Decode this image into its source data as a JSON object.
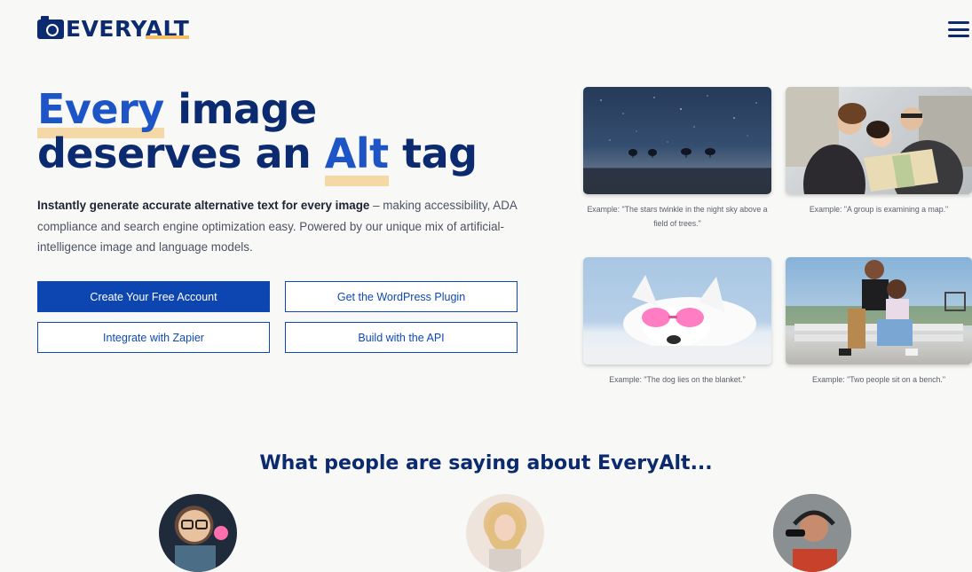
{
  "brand": {
    "name_prefix": "EVERY",
    "name_suffix": "ALT"
  },
  "hero": {
    "headline_line1_highlight": "Every",
    "headline_line1_rest": " image",
    "headline_line2_start": "deserves an ",
    "headline_line2_highlight": "Alt",
    "headline_line2_end": " tag",
    "intro_bold": "Instantly generate accurate alternative text for every image",
    "intro_rest": " – making accessibility, ADA compliance and search engine optimization easy. Powered by our unique mix of artificial-intelligence image and language models."
  },
  "buttons": {
    "create_account": "Create Your Free Account",
    "wordpress_plugin": "Get the WordPress Plugin",
    "zapier": "Integrate with Zapier",
    "api": "Build with the API"
  },
  "examples": [
    {
      "caption": "Example: \"The stars twinkle in the night sky above a field of trees.\""
    },
    {
      "caption": "Example: \"A group is examining a map.\""
    },
    {
      "caption": "Example: \"The dog lies on the blanket.\""
    },
    {
      "caption": "Example: \"Two people sit on a bench.\""
    }
  ],
  "testimonials": {
    "title": "What people are saying about EveryAlt..."
  },
  "colors": {
    "brand_navy": "#0b2a6f",
    "button_blue": "#0e46b1",
    "highlight_blue": "#1e55c6",
    "underline_gold": "#f4d9a6"
  },
  "icons": {
    "logo": "camera-icon",
    "menu": "hamburger-menu-icon"
  }
}
